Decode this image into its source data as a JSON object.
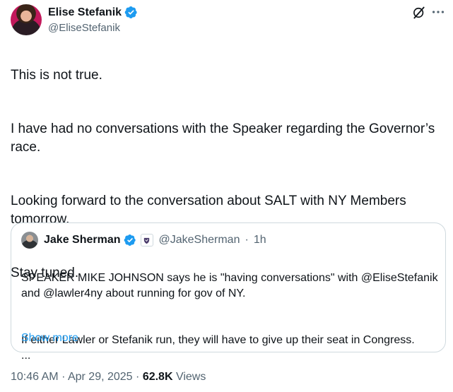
{
  "author": {
    "display_name": "Elise Stefanik",
    "handle": "@EliseStefanik",
    "verified": true
  },
  "icons": {
    "verified": "verified-badge-icon",
    "grok": "grok-icon",
    "more": "more-options-icon"
  },
  "tweet": {
    "paragraphs": [
      "This is not true.",
      "I have had no conversations with the Speaker regarding the Governor’s race.",
      "Looking forward to the conversation about SALT with NY Members tomorrow.",
      "Stay tuned."
    ]
  },
  "quote": {
    "display_name": "Jake Sherman",
    "handle": "@JakeSherman",
    "separator": "·",
    "time": "1h",
    "paragraphs": [
      "SPEAKER MIKE JOHNSON says he is \"having conversations\" with @EliseStefanik and @lawler4ny about running for gov of NY.",
      "If either Lawler or Stefanik run, they will have to give up their seat in Congress.\n..."
    ],
    "show_more": "Show more"
  },
  "meta": {
    "time": "10:46 AM",
    "separator1": "·",
    "date": "Apr 29, 2025",
    "separator2": "·",
    "views_count": "62.8K",
    "views_label": "Views"
  },
  "colors": {
    "accent": "#1d9bf0",
    "secondary_text": "#536471",
    "primary_text": "#0f1419",
    "border": "#cfd9de"
  }
}
